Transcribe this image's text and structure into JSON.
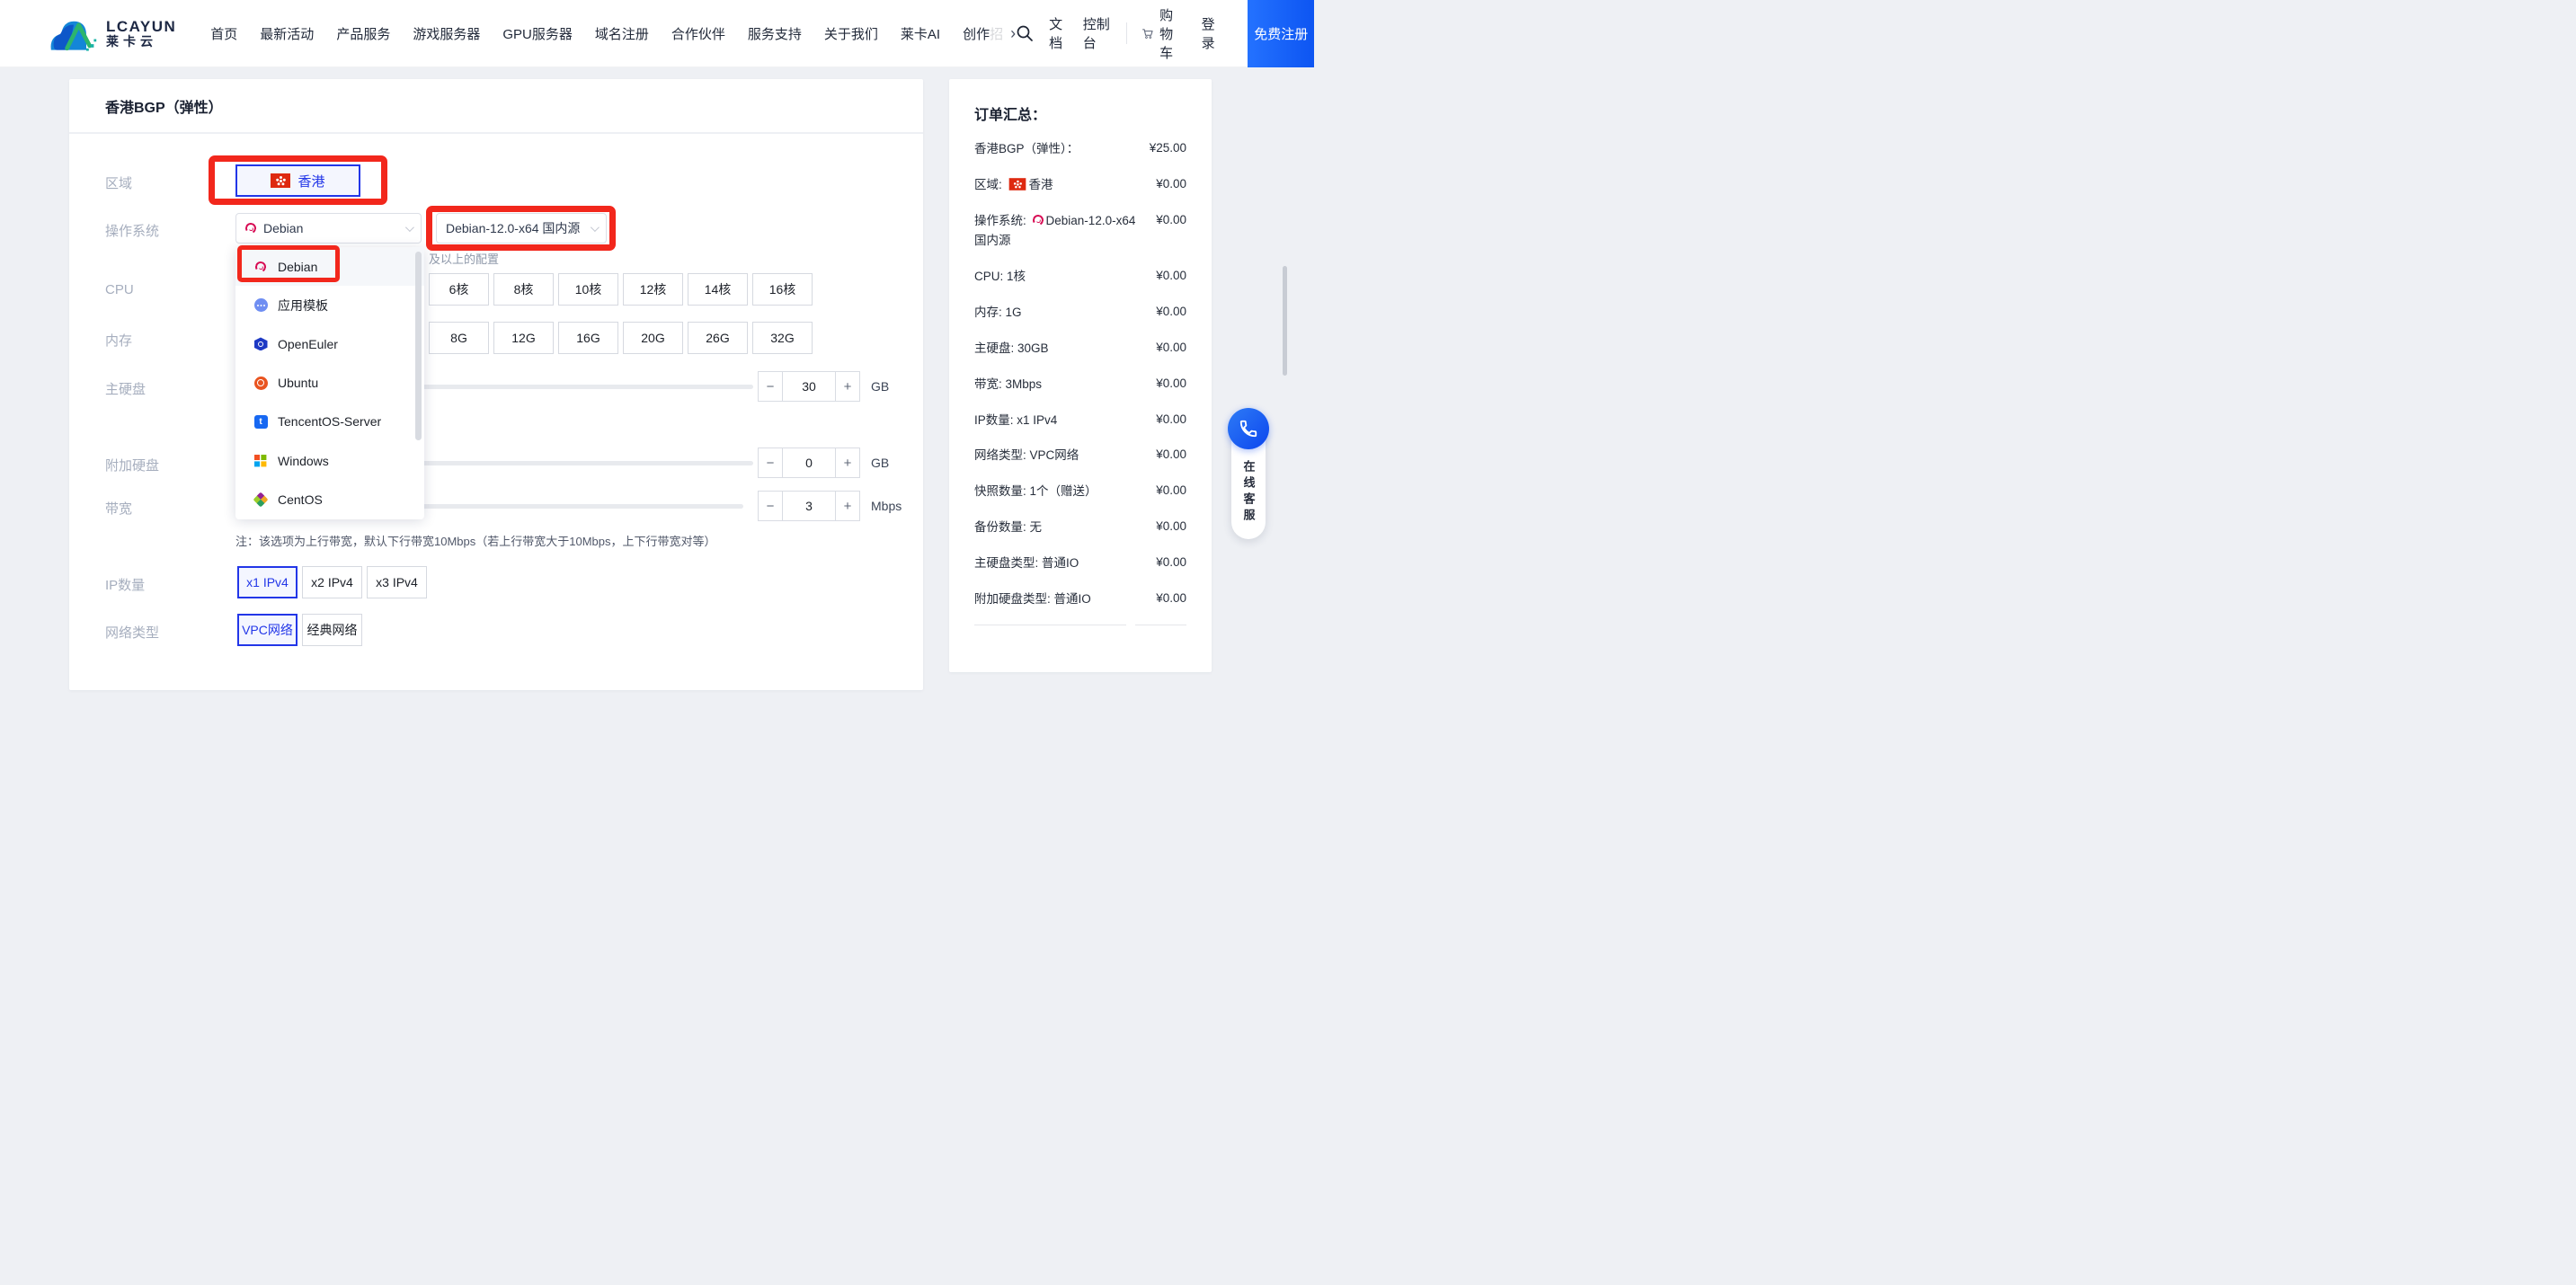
{
  "nav": {
    "logo": {
      "brand": "LCAYUN",
      "brand_cn": "莱卡云"
    },
    "items": [
      {
        "label": "首页"
      },
      {
        "label": "最新活动"
      },
      {
        "label": "产品服务"
      },
      {
        "label": "游戏服务器"
      },
      {
        "label": "GPU服务器"
      },
      {
        "label": "域名注册"
      },
      {
        "label": "合作伙伴"
      },
      {
        "label": "服务支持"
      },
      {
        "label": "关于我们"
      },
      {
        "label": "莱卡AI"
      },
      {
        "label": "创作",
        "tail": "招"
      }
    ],
    "more_chevron": "›",
    "utility": {
      "docs": "文档",
      "console": "控制台",
      "cart": "购物车",
      "login": "登录",
      "cta": "免费注册"
    }
  },
  "config": {
    "title": "香港BGP（弹性）",
    "region": {
      "label": "区域",
      "selected_option": "香港"
    },
    "os": {
      "label": "操作系统",
      "family": "Debian",
      "version": "Debian-12.0-x64 国内源",
      "note_tail": "及以上的配置"
    },
    "os_dropdown": {
      "items": [
        {
          "label": "Debian",
          "icon": "glyph-debian",
          "active": true
        },
        {
          "label": "应用模板",
          "icon": "glyph-app"
        },
        {
          "label": "OpenEuler",
          "icon": "glyph-euler"
        },
        {
          "label": "Ubuntu",
          "icon": "glyph-ubuntu"
        },
        {
          "label": "TencentOS-Server",
          "icon": "glyph-tencent"
        },
        {
          "label": "Windows",
          "icon": "glyph-windows"
        },
        {
          "label": "CentOS",
          "icon": "glyph-centos"
        }
      ]
    },
    "cpu": {
      "label": "CPU",
      "options": [
        {
          "label": "6核"
        },
        {
          "label": "8核"
        },
        {
          "label": "10核"
        },
        {
          "label": "12核"
        },
        {
          "label": "14核"
        },
        {
          "label": "16核"
        }
      ]
    },
    "memory": {
      "label": "内存",
      "options": [
        {
          "label": "8G"
        },
        {
          "label": "12G"
        },
        {
          "label": "16G"
        },
        {
          "label": "20G"
        },
        {
          "label": "26G"
        },
        {
          "label": "32G"
        }
      ]
    },
    "disk": {
      "label": "主硬盘",
      "value": "30",
      "unit": "GB"
    },
    "extra_disk": {
      "label": "附加硬盘",
      "value": "0",
      "unit": "GB"
    },
    "bandwidth": {
      "label": "带宽",
      "value": "3",
      "unit": "Mbps",
      "note": "注：该选项为上行带宽，默认下行带宽10Mbps（若上行带宽大于10Mbps，上下行带宽对等）"
    },
    "ip": {
      "label": "IP数量",
      "options": [
        {
          "label": "x1 IPv4",
          "selected": true
        },
        {
          "label": "x2 IPv4"
        },
        {
          "label": "x3 IPv4"
        }
      ]
    },
    "network": {
      "label": "网络类型",
      "options": [
        {
          "label": "VPC网络",
          "selected": true
        },
        {
          "label": "经典网络"
        }
      ]
    },
    "stepper": {
      "minus": "−",
      "plus": "+"
    }
  },
  "summary": {
    "title": "订单汇总：",
    "items": [
      {
        "pre": "香港BGP（弹性）：",
        "price": "¥25.00"
      },
      {
        "pre": "区域:",
        "hk": true,
        "text": "香港",
        "price": "¥0.00"
      },
      {
        "pre": "操作系统:",
        "debian": true,
        "text": "Debian-12.0-x64 国内源",
        "price": "¥0.00"
      },
      {
        "pre": "CPU: 1核",
        "price": "¥0.00"
      },
      {
        "pre": "内存: 1G",
        "price": "¥0.00"
      },
      {
        "pre": "主硬盘: 30GB",
        "price": "¥0.00"
      },
      {
        "pre": "带宽: 3Mbps",
        "price": "¥0.00"
      },
      {
        "pre": "IP数量: x1 IPv4",
        "price": "¥0.00"
      },
      {
        "pre": "网络类型: VPC网络",
        "price": "¥0.00"
      },
      {
        "pre": "快照数量: 1个（赠送）",
        "price": "¥0.00"
      },
      {
        "pre": "备份数量: 无",
        "price": "¥0.00"
      },
      {
        "pre": "主硬盘类型: 普通IO",
        "price": "¥0.00"
      },
      {
        "pre": "附加硬盘类型: 普通IO",
        "price": "¥0.00"
      }
    ]
  },
  "widget": {
    "label": "在线客服"
  },
  "colors": {
    "accent_blue": "#1a5eff",
    "selected_blue": "#2236e8",
    "annotation_red": "#f2271c",
    "flag_red": "#de2910",
    "debian_red": "#d70a53"
  }
}
